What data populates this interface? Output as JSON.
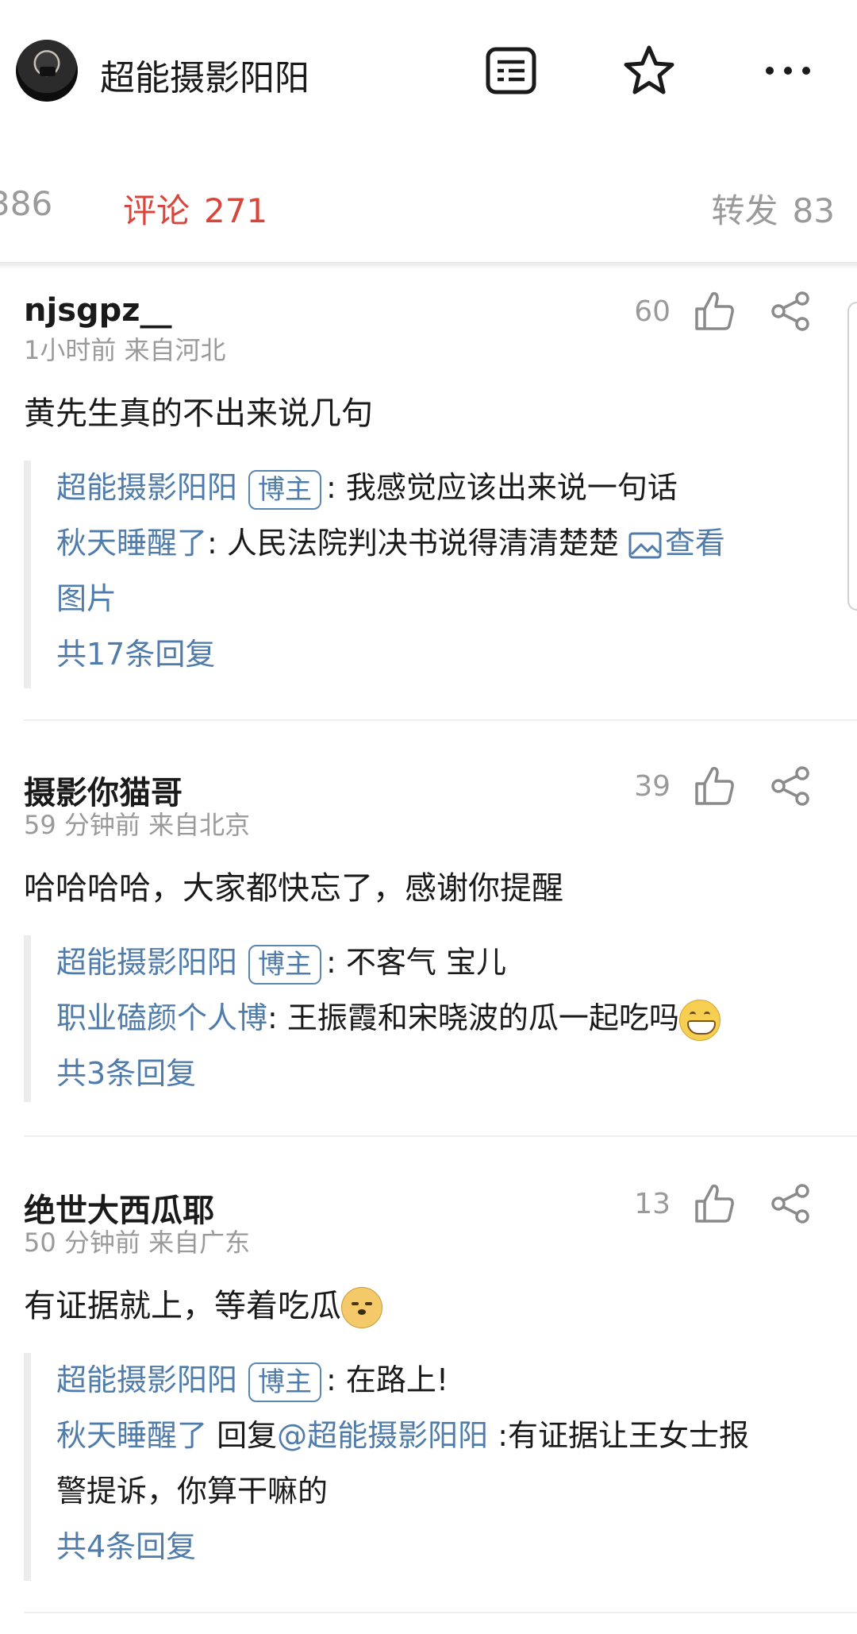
{
  "header": {
    "title": "超能摄影阳阳",
    "icons": [
      "avatar",
      "article-list-icon",
      "star-icon",
      "more-icon"
    ]
  },
  "tabs": {
    "likes_partial": "386",
    "comments_label": "评论",
    "comments_count": "271",
    "reposts_label": "转发",
    "reposts_count": "83",
    "active": "comments",
    "active_color": "#d8453a"
  },
  "comments": [
    {
      "user": "njsgpz__",
      "meta": "1小时前  来自河北",
      "likes": "60",
      "text": "黄先生真的不出来说几句",
      "replies": {
        "r1_user": "超能摄影阳阳",
        "r1_badge": "博主",
        "r1_text": ": 我感觉应该出来说一句话",
        "r2_user": "秋天睡醒了",
        "r2_text": ": 人民法院判决书说得清清楚楚",
        "r2_link": "查看",
        "r2_link_cont": "图片",
        "more": "共17条回复"
      }
    },
    {
      "user": "摄影你猫哥",
      "meta": "59 分钟前  来自北京",
      "likes": "39",
      "text": "哈哈哈哈，大家都快忘了，感谢你提醒",
      "replies": {
        "r1_user": "超能摄影阳阳",
        "r1_badge": "博主",
        "r1_text": ": 不客气 宝儿",
        "r2_user": "职业磕颜个人博",
        "r2_text": ": 王振霞和宋晓波的瓜一起吃吗",
        "more": "共3条回复"
      }
    },
    {
      "user": "绝世大西瓜耶",
      "meta": "50 分钟前  来自广东",
      "likes": "13",
      "text": "有证据就上，等着吃瓜",
      "replies": {
        "r1_user": "超能摄影阳阳",
        "r1_badge": "博主",
        "r1_text": ": 在路上!",
        "r2_user": "秋天睡醒了",
        "r2_reply_word": " 回复",
        "r2_mention": "@超能摄影阳阳",
        "r2_text": " :有证据让王女士报",
        "r2_text_cont": "警提诉，你算干嘛的",
        "more": "共4条回复"
      }
    }
  ],
  "colors": {
    "link_blue": "#4f7caa",
    "muted": "#9a9a9a",
    "accent": "#d8453a"
  }
}
